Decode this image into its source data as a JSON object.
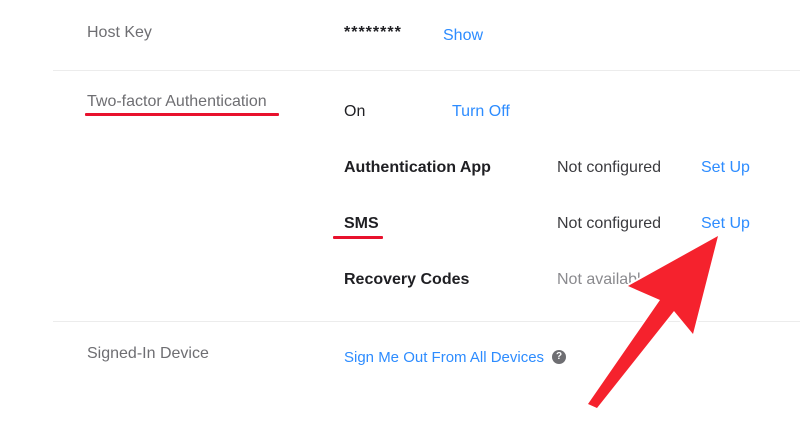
{
  "host_key": {
    "label": "Host Key",
    "masked_value": "********",
    "show_link": "Show"
  },
  "two_factor": {
    "label": "Two-factor Authentication",
    "status": "On",
    "toggle_link": "Turn Off",
    "methods": [
      {
        "name": "Authentication App",
        "status": "Not configured",
        "action": "Set Up"
      },
      {
        "name": "SMS",
        "status": "Not configured",
        "action": "Set Up"
      },
      {
        "name": "Recovery Codes",
        "status": "Not available"
      }
    ]
  },
  "signed_in_device": {
    "label": "Signed-In Device",
    "sign_out_link": "Sign Me Out From All Devices",
    "help_icon_glyph": "?"
  },
  "annotation": {
    "highlight_color": "#e8112d",
    "arrow_color": "#f5222d"
  },
  "colors": {
    "link": "#2d8cff",
    "label": "#6e6e72",
    "divider": "#ececec"
  }
}
